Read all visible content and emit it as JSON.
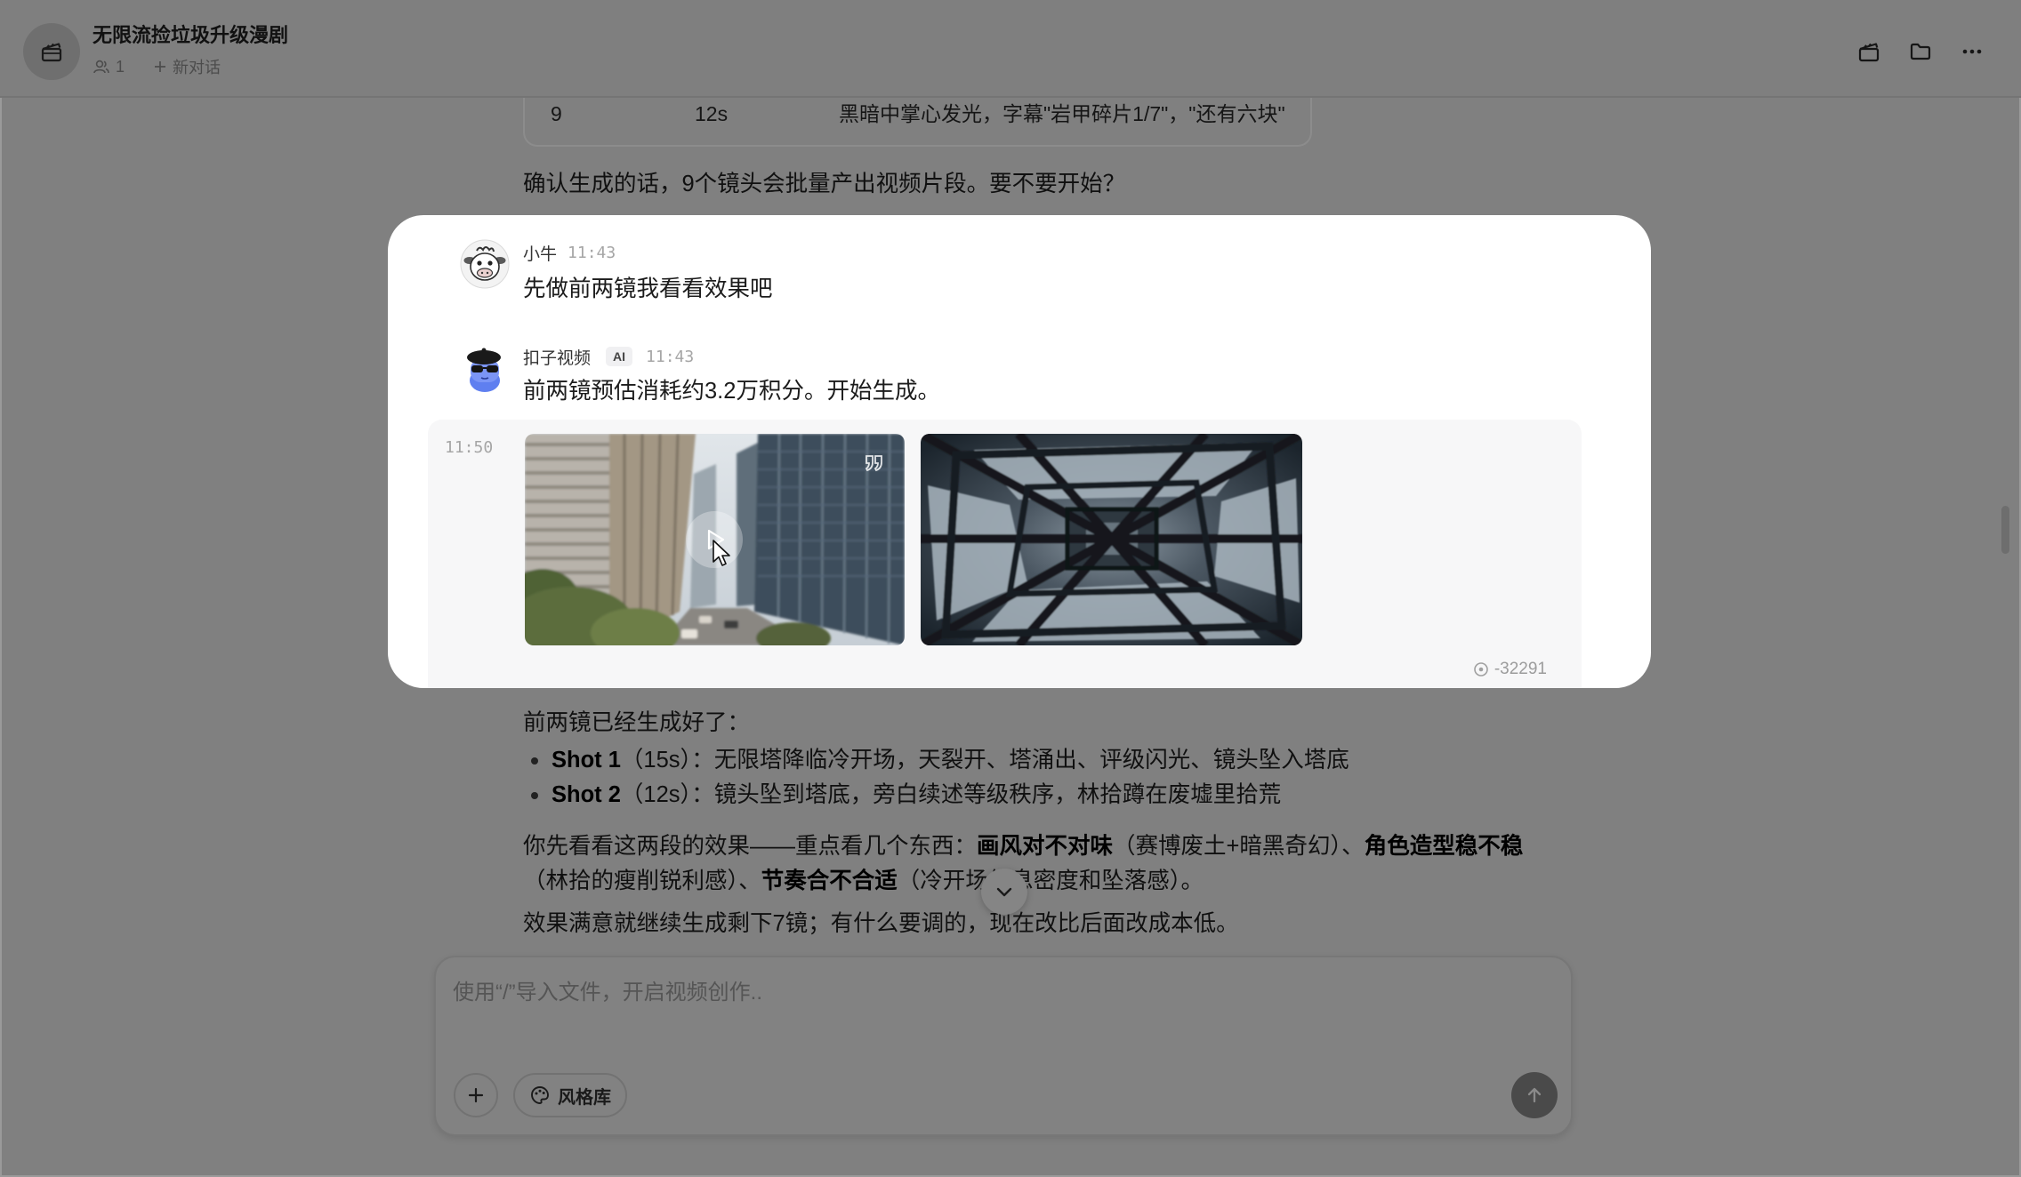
{
  "header": {
    "title": "无限流捡垃圾升级漫剧",
    "member_count": "1",
    "new_chat_label": "新对话",
    "actions": [
      "clapperboard-icon",
      "folder-icon",
      "more-icon"
    ]
  },
  "shot_table": {
    "last_row": {
      "shot": "9",
      "duration": "12s",
      "content": "黑暗中掌心发光，字幕\"岩甲碎片1/7\"，\"还有六块\""
    }
  },
  "conversation": {
    "ai_prompt": "确认生成的话，9个镜头会批量产出视频片段。要不要开始？",
    "user_message": {
      "name": "小牛",
      "time": "11:43",
      "text": "先做前两镜我看看效果吧"
    },
    "ai_message": {
      "name": "扣子视频",
      "badge": "AI",
      "time": "11:43",
      "text": "前两镜预估消耗约3.2万积分。开始生成。"
    },
    "generation_result": {
      "time": "11:50",
      "credits_used": "-32291"
    },
    "ai_reply": {
      "intro": "前两镜已经生成好了：",
      "shots": [
        {
          "title": "Shot 1",
          "duration": "（15s）：",
          "description": "无限塔降临冷开场，天裂开、塔涌出、评级闪光、镜头坠入塔底"
        },
        {
          "title": "Shot 2",
          "duration": "（12s）：",
          "description": "镜头坠到塔底，旁白续述等级秩序，林拾蹲在废墟里拾荒"
        }
      ],
      "review_line1": [
        "你先看看这两段的效果——重点看几个东西：",
        "画风对不对味",
        "（赛博废土+暗黑奇幻）、",
        "角色造型稳不稳"
      ],
      "review_line2": [
        "（林拾的瘦削锐利感）、",
        "节奏合不合适",
        "（冷开场信息密度和坠落感）。"
      ],
      "closing": "效果满意就继续生成剩下7镜；有什么要调的，现在改比后面改成本低。"
    }
  },
  "composer": {
    "placeholder": "使用“/”导入文件，开启视频创作..",
    "style_library_label": "风格库"
  },
  "colors": {
    "overlay_background": "#808080",
    "highlight_card": "#ffffff",
    "media_block": "#f7f7f8",
    "send_button": "#4a4a4a"
  }
}
